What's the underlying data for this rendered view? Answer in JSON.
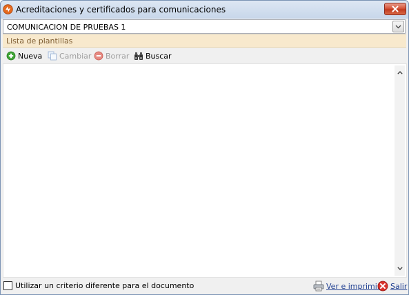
{
  "window": {
    "title": "Acreditaciones y certificados para comunicaciones"
  },
  "combo": {
    "selected": "COMUNICACION DE PRUEBAS 1"
  },
  "group": {
    "header": "Lista de plantillas"
  },
  "toolbar": {
    "new_label": "Nueva",
    "change_label": "Cambiar",
    "delete_label": "Borrar",
    "search_label": "Buscar"
  },
  "footer": {
    "checkbox_label": "Utilizar un criterio diferente para el documento",
    "checkbox_checked": false,
    "print_label": "Ver e imprimir",
    "exit_label": "Salir"
  },
  "colors": {
    "group_header_bg": "#f8e9cd",
    "group_header_text": "#7b5a2f",
    "link": "#1f3f91",
    "close_button": "#c13a1e"
  }
}
